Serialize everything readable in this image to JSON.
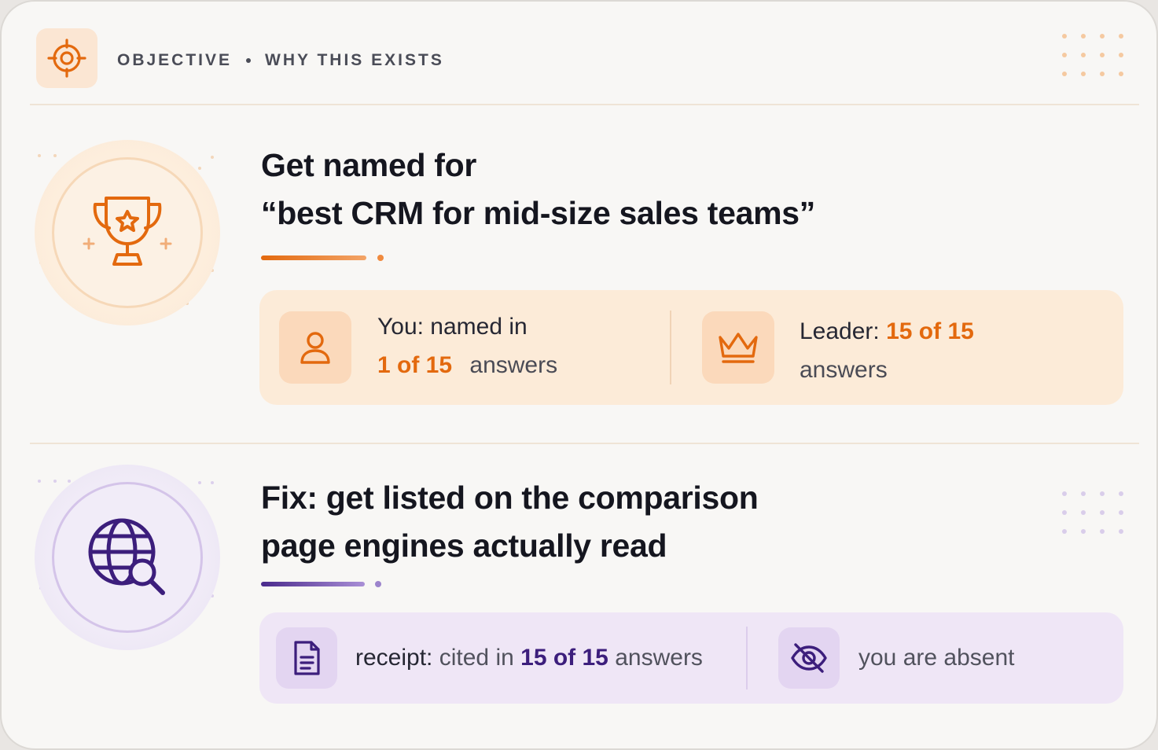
{
  "header": {
    "label_primary": "OBJECTIVE",
    "label_secondary": "WHY THIS EXISTS",
    "icon": "target-icon"
  },
  "objective": {
    "title_line1": "Get named for",
    "title_line2": "“best CRM for mid-size sales teams”",
    "icon": "trophy-icon",
    "you": {
      "icon": "user-icon",
      "prefix": "You: named in",
      "value": "1 of 15",
      "suffix": "answers"
    },
    "leader": {
      "icon": "crown-icon",
      "prefix": "Leader:",
      "value": "15 of 15",
      "suffix": "answers"
    }
  },
  "fix": {
    "title_line1": "Fix: get listed on the comparison",
    "title_line2": "page engines actually read",
    "icon": "globe-search-icon",
    "receipt": {
      "icon": "document-icon",
      "prefix": "receipt:",
      "middle": "cited in",
      "value": "15 of 15",
      "suffix": "answers"
    },
    "absent": {
      "icon": "eye-off-icon",
      "text": "you are absent"
    }
  },
  "colors": {
    "accent_orange": "#e3690e",
    "accent_purple": "#3c1e7c",
    "panel_orange": "#fcebd8",
    "panel_purple": "#efe6f6"
  }
}
